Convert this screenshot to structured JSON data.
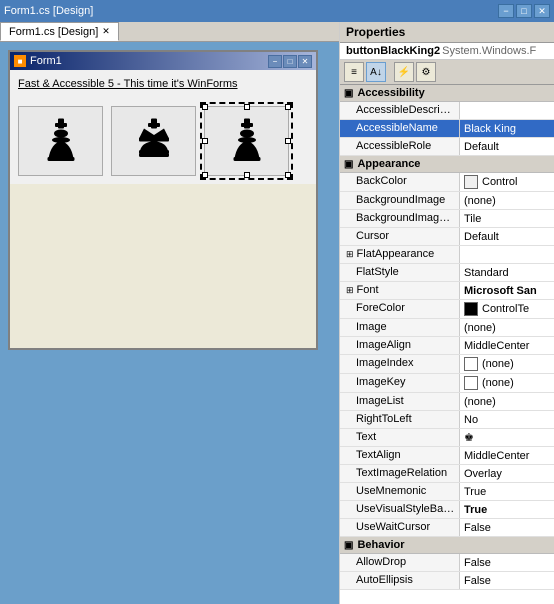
{
  "titleBar": {
    "text": "Form1.cs [Design]",
    "buttons": [
      "−",
      "□",
      "✕"
    ]
  },
  "tabs": [
    {
      "label": "Form1.cs [Design]",
      "active": true,
      "closable": true
    }
  ],
  "formWindow": {
    "title": "Form1",
    "label": "Fast & Accessible 5 - This time it's WinForms"
  },
  "properties": {
    "header": "Properties",
    "objectName": "buttonBlackKing2",
    "objectType": "System.Windows.F",
    "toolbar": {
      "buttons": [
        "≡",
        "A↓",
        "⚡",
        "⚙"
      ]
    },
    "sections": [
      {
        "name": "Accessibility",
        "expanded": true,
        "rows": [
          {
            "name": "AccessibleDescription",
            "value": "",
            "highlighted": false
          },
          {
            "name": "AccessibleName",
            "value": "Black King",
            "highlighted": true
          },
          {
            "name": "AccessibleRole",
            "value": "Default",
            "highlighted": false
          }
        ]
      },
      {
        "name": "Appearance",
        "expanded": true,
        "rows": [
          {
            "name": "BackColor",
            "value": "Control",
            "hasColor": true,
            "colorHex": "#f0f0f0",
            "highlighted": false
          },
          {
            "name": "BackgroundImage",
            "value": "(none)",
            "highlighted": false
          },
          {
            "name": "BackgroundImageLay",
            "value": "Tile",
            "highlighted": false
          },
          {
            "name": "Cursor",
            "value": "Default",
            "highlighted": false
          },
          {
            "name": "FlatAppearance",
            "value": "",
            "expandable": true,
            "highlighted": false
          },
          {
            "name": "FlatStyle",
            "value": "Standard",
            "highlighted": false
          },
          {
            "name": "Font",
            "value": "Microsoft San",
            "bold": true,
            "expandable": true,
            "highlighted": false
          },
          {
            "name": "ForeColor",
            "value": "ControlTe",
            "hasColor": true,
            "colorHex": "#000000",
            "highlighted": false
          },
          {
            "name": "Image",
            "value": "(none)",
            "highlighted": false
          },
          {
            "name": "ImageAlign",
            "value": "MiddleCenter",
            "highlighted": false
          },
          {
            "name": "ImageIndex",
            "value": "(none)",
            "hasColor": true,
            "colorHex": "#ffffff",
            "highlighted": false
          },
          {
            "name": "ImageKey",
            "value": "(none)",
            "hasColor": true,
            "colorHex": "#ffffff",
            "highlighted": false
          },
          {
            "name": "ImageList",
            "value": "(none)",
            "highlighted": false
          },
          {
            "name": "RightToLeft",
            "value": "No",
            "highlighted": false
          },
          {
            "name": "Text",
            "value": "♚",
            "highlighted": false
          },
          {
            "name": "TextAlign",
            "value": "MiddleCenter",
            "highlighted": false
          },
          {
            "name": "TextImageRelation",
            "value": "Overlay",
            "highlighted": false
          },
          {
            "name": "UseMnemonic",
            "value": "True",
            "highlighted": false
          },
          {
            "name": "UseVisualStyleBackC",
            "value": "True",
            "bold": true,
            "highlighted": false
          },
          {
            "name": "UseWaitCursor",
            "value": "False",
            "highlighted": false
          }
        ]
      },
      {
        "name": "Behavior",
        "expanded": true,
        "rows": [
          {
            "name": "AllowDrop",
            "value": "False",
            "highlighted": false
          },
          {
            "name": "AutoEllipsis",
            "value": "False",
            "highlighted": false
          }
        ]
      }
    ]
  }
}
